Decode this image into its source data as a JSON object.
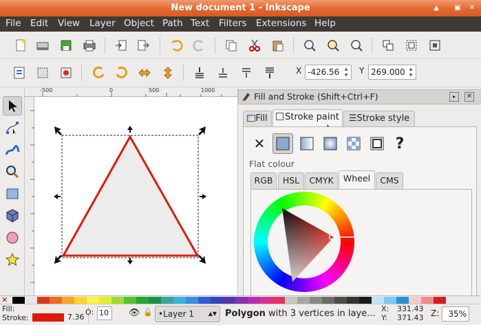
{
  "window": {
    "title": "New document 1 - Inkscape"
  },
  "menu": [
    "File",
    "Edit",
    "View",
    "Layer",
    "Object",
    "Path",
    "Text",
    "Filters",
    "Extensions",
    "Help"
  ],
  "controls": {
    "x_label": "X",
    "x_value": "-426.56",
    "y_label": "Y",
    "y_value": "269.000"
  },
  "ruler": {
    "h_ticks": [
      "-500",
      "0",
      "500",
      "1000"
    ]
  },
  "panel": {
    "title": "Fill and Stroke (Shift+Ctrl+F)",
    "tabs": [
      "Fill",
      "Stroke paint",
      "Stroke style"
    ],
    "section_label": "Flat colour",
    "color_tabs": [
      "RGB",
      "HSL",
      "CMYK",
      "Wheel",
      "CMS"
    ]
  },
  "status": {
    "fill_label": "Fill:",
    "stroke_label": "Stroke:",
    "stroke_width": "7.36",
    "opacity_label": "O:",
    "opacity_value": "10",
    "layer": "•Layer 1",
    "message_bold": "Polygon",
    "message": " with 3 vertices in laye...",
    "x_label": "X:",
    "x_value": "331.43",
    "y_label": "Y:",
    "y_value": "371.43",
    "zoom_label": "Z:",
    "zoom_value": "35%"
  },
  "colors": {
    "stroke": "#dd1a0a",
    "titlebar": "#e3672e",
    "menubar": "#3c3b37"
  }
}
